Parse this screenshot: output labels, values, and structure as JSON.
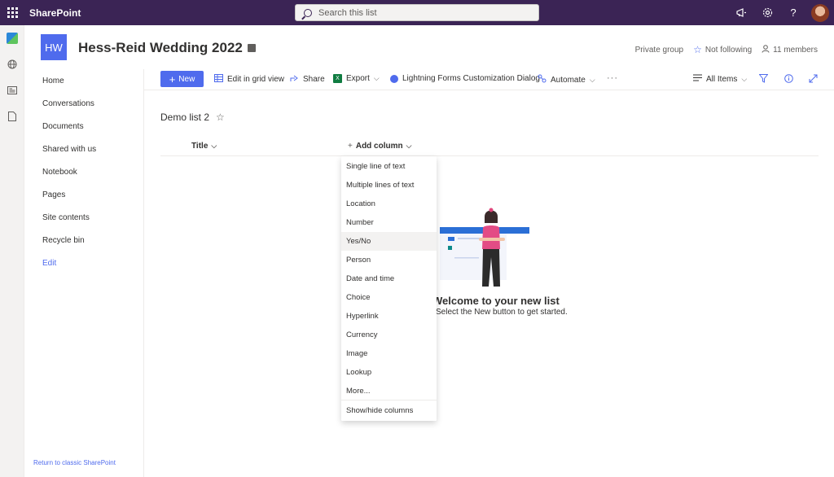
{
  "suite": {
    "brand": "SharePoint",
    "search_placeholder": "Search this list",
    "icons": [
      "megaphone-icon",
      "gear-icon",
      "help-icon"
    ]
  },
  "appbar": {
    "icons": [
      "site-icon",
      "globe-icon",
      "news-icon",
      "file-icon"
    ]
  },
  "site": {
    "logo_initials": "HW",
    "title": "Hess-Reid Wedding 2022",
    "privacy": "Private group",
    "follow": "Not following",
    "members": "11 members"
  },
  "leftnav": {
    "items": [
      "Home",
      "Conversations",
      "Documents",
      "Shared with us",
      "Notebook",
      "Pages",
      "Site contents",
      "Recycle bin"
    ],
    "edit": "Edit",
    "return_classic": "Return to classic SharePoint"
  },
  "cmdbar": {
    "new": "New",
    "grid_view": "Edit in grid view",
    "share": "Share",
    "export": "Export",
    "lightning": "Lightning Forms Customization Dialog",
    "automate": "Automate",
    "view": "All Items"
  },
  "list": {
    "title": "Demo list 2",
    "col_title": "Title",
    "add_column": "Add column"
  },
  "dropdown": {
    "items": [
      "Single line of text",
      "Multiple lines of text",
      "Location",
      "Number",
      "Yes/No",
      "Person",
      "Date and time",
      "Choice",
      "Hyperlink",
      "Currency",
      "Image",
      "Lookup",
      "More..."
    ],
    "hovered_index": 4,
    "show_hide": "Show/hide columns"
  },
  "empty_state": {
    "title": "Welcome to your new list",
    "subtitle": "Select the New button to get started."
  },
  "colors": {
    "suitebar": "#3b2455",
    "accent": "#4f6bed"
  }
}
